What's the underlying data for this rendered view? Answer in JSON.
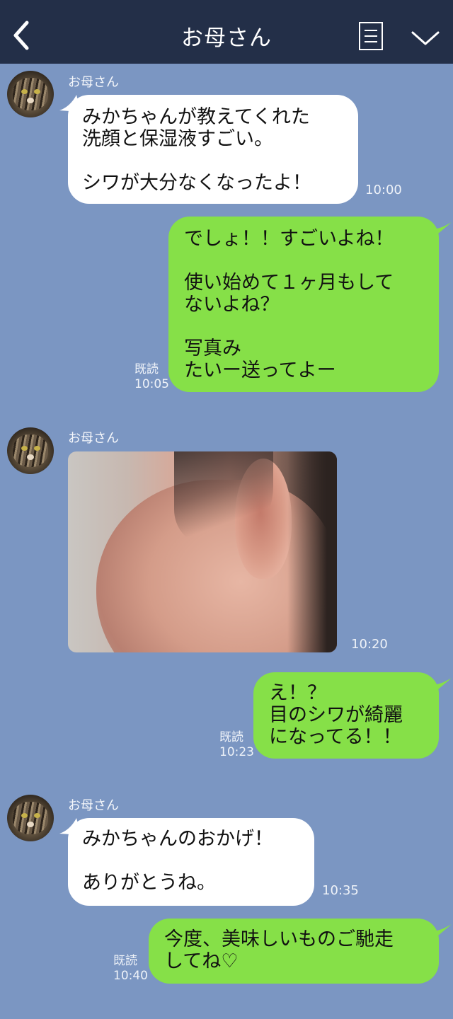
{
  "header": {
    "title": "お母さん",
    "back_icon": "chevron-left-icon",
    "menu_icon": "notes-icon",
    "expand_icon": "chevron-down-icon",
    "bg_color": "#232f48"
  },
  "colors": {
    "background": "#7b96c2",
    "incoming_bubble": "#ffffff",
    "outgoing_bubble": "#86e048"
  },
  "messages": [
    {
      "sender": "お母さん",
      "text": "みかちゃんが教えてくれた\n洗顔と保湿液すごい。\n\nシワが大分なくなったよ！",
      "time": "10:00"
    },
    {
      "text": "でしょ！！すごいよね！\n\n使い始めて１ヶ月もして\nないよね？\n\n写真み\nたいー送ってよー",
      "read": "既読",
      "time": "10:05"
    },
    {
      "sender": "お母さん",
      "image": "photo-of-face-profile",
      "time": "10:20"
    },
    {
      "text": "え！？\n目のシワが綺麗\nになってる！！",
      "read": "既読",
      "time": "10:23"
    },
    {
      "sender": "お母さん",
      "text": "みかちゃんのおかげ！\n\nありがとうね。",
      "time": "10:35"
    },
    {
      "text": "今度、美味しいものご馳走\nしてね♡",
      "read": "既読",
      "time": "10:40"
    }
  ]
}
